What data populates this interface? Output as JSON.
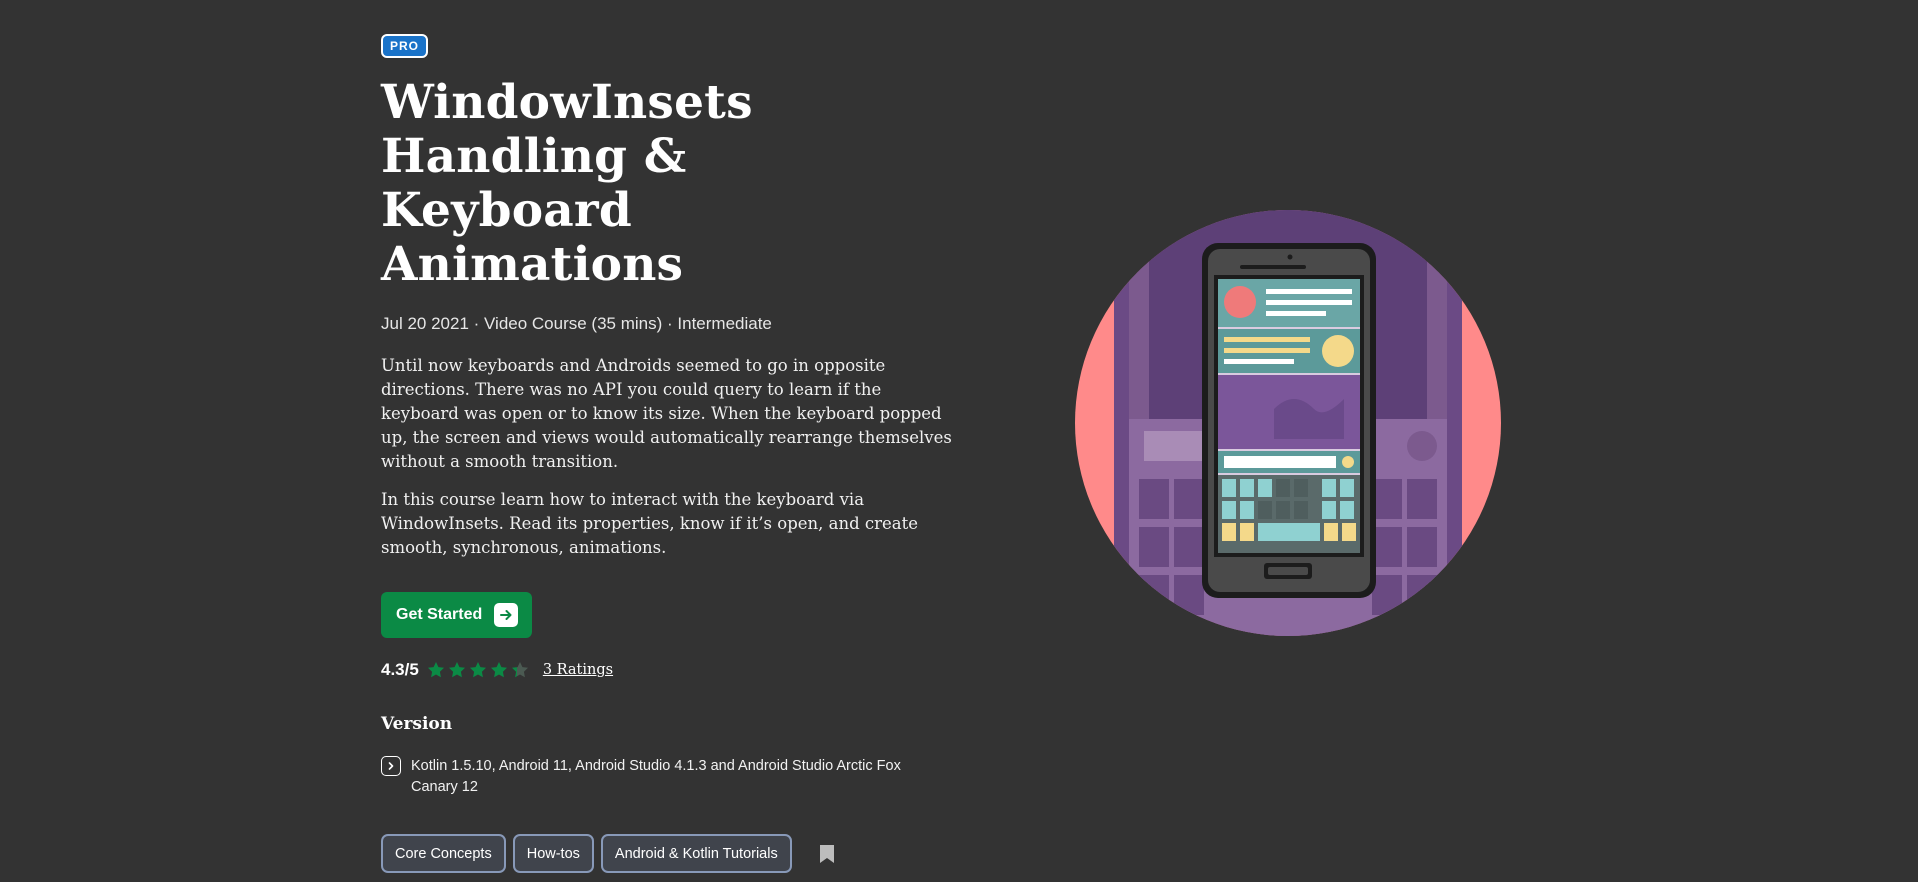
{
  "badge": "PRO",
  "title": "WindowInsets Handling & Keyboard Animations",
  "meta": "Jul 20 2021 · Video Course (35 mins) · Intermediate",
  "description": [
    "Until now keyboards and Androids seemed to go in opposite directions. There was no API you could query to learn if the keyboard was open or to know its size. When the keyboard popped up, the screen and views would automatically rearrange themselves without a smooth transition.",
    "In this course learn how to interact with the keyboard via WindowInsets. Read its properties, know if it’s open, and create smooth, synchronous, animations."
  ],
  "cta": {
    "label": "Get Started",
    "icon": "arrow-right-icon"
  },
  "rating": {
    "score": "4.3/5",
    "value": 4.3,
    "max": 5,
    "count_label": "3 Ratings"
  },
  "version": {
    "heading": "Version",
    "text": "Kotlin 1.5.10, Android 11, Android Studio 4.1.3 and Android Studio Arctic Fox Canary 12",
    "icon": "chevron-right-box-icon"
  },
  "tags": [
    "Core Concepts",
    "How-tos",
    "Android & Kotlin Tutorials"
  ],
  "bookmark_icon": "bookmark-icon",
  "colors": {
    "background": "#333333",
    "pro_badge": "#1a73c9",
    "cta": "#0b8a45",
    "star": "#0b8a45",
    "illustration_purple": "#6b4a85",
    "illustration_pink": "#ff8a8a"
  }
}
